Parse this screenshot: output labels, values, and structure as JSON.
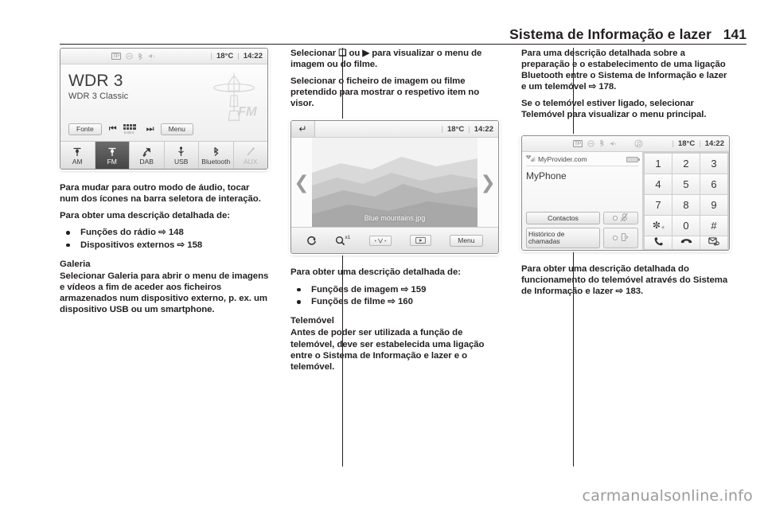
{
  "header": {
    "title": "Sistema de Informação e lazer",
    "page_number": "141"
  },
  "radio_screen": {
    "status": {
      "tp": "TP",
      "temperature": "18°C",
      "time": "14:22",
      "icons": [
        "tp-badge-icon",
        "no-traffic-icon",
        "bluetooth-icon",
        "mute-icon"
      ]
    },
    "station_name": "WDR 3",
    "station_info": "WDR 3 Classic",
    "band_logo": "FM",
    "controls": {
      "source_label": "Fonte",
      "prev_icon": "skip-previous-icon",
      "keypad_icon": "keypad-icon",
      "keypad_sublabel": "Entbriz",
      "next_icon": "skip-next-icon",
      "menu_label": "Menu"
    },
    "tabs": [
      {
        "label": "AM",
        "icon": "antenna-icon",
        "state": "normal"
      },
      {
        "label": "FM",
        "icon": "antenna-icon",
        "state": "active"
      },
      {
        "label": "DAB",
        "icon": "satellite-icon",
        "state": "normal"
      },
      {
        "label": "USB",
        "icon": "usb-icon",
        "state": "normal"
      },
      {
        "label": "Bluetooth",
        "icon": "bluetooth-icon",
        "state": "normal"
      },
      {
        "label": "AUX",
        "icon": "aux-plug-icon",
        "state": "disabled"
      }
    ]
  },
  "gallery_screen": {
    "back_icon": "back-arrow-icon",
    "temperature": "18°C",
    "time": "14:22",
    "prev_chevron": "chevron-left-icon",
    "next_chevron": "chevron-right-icon",
    "photo_filename": "Blue mountains.jpg",
    "toolbar": {
      "rotate_icon": "rotate-icon",
      "zoom_icon": "zoom-icon",
      "zoom_level": "x1",
      "adjust_icon": "fit-screen-icon",
      "slideshow_icon": "slideshow-play-icon",
      "menu_label": "Menu"
    }
  },
  "phone_screen": {
    "status": {
      "tp": "TP",
      "temperature": "18°C",
      "time": "14:22",
      "icons": [
        "tp-badge-icon",
        "no-traffic-icon",
        "bluetooth-icon",
        "mute-icon",
        "media-note-icon"
      ]
    },
    "provider": "MyProvider.com",
    "signal_icon": "signal-bars-icon",
    "battery_icon": "battery-icon",
    "phone_name": "MyPhone",
    "contacts_label": "Contactos",
    "call_history_label": "Histórico de chamadas",
    "toggle_icons": [
      "mute-microphone-icon",
      "handset-transfer-icon"
    ],
    "keypad": [
      {
        "label": "1",
        "sup": ""
      },
      {
        "label": "2",
        "sup": ""
      },
      {
        "label": "3",
        "sup": ""
      },
      {
        "label": "4",
        "sup": ""
      },
      {
        "label": "5",
        "sup": ""
      },
      {
        "label": "6",
        "sup": ""
      },
      {
        "label": "7",
        "sup": ""
      },
      {
        "label": "8",
        "sup": ""
      },
      {
        "label": "9",
        "sup": ""
      },
      {
        "label": "✼",
        "sup": "+"
      },
      {
        "label": "0",
        "sup": ""
      },
      {
        "label": "#",
        "sup": ""
      }
    ],
    "call_buttons": [
      {
        "icon": "call-answer-icon"
      },
      {
        "icon": "call-end-icon"
      },
      {
        "icon": "voicemail-icon"
      }
    ]
  },
  "column_left": {
    "p1": "Para mudar para outro modo de áudio, tocar num dos ícones na barra seletora de interação.",
    "p2": "Para obter uma descrição detalhada de:",
    "bullets": [
      {
        "text": "Funções do rádio",
        "arrow": "⇨",
        "page": "148"
      },
      {
        "text": "Dispositivos externos",
        "arrow": "⇨",
        "page": "158"
      }
    ],
    "heading": "Galeria",
    "p3": "Selecionar Galeria para abrir o menu de imagens e vídeos a fim de aceder aos ficheiros armazenados num dispositivo externo, p. ex. um dispositivo USB ou um smartphone."
  },
  "column_middle": {
    "p1": "Selecionar ❑ ou ▶ para visualizar o menu de imagem ou do filme.",
    "p2": "Selecionar o ficheiro de imagem ou filme pretendido para mostrar o respetivo item no visor.",
    "p3": "Para obter uma descrição detalhada de:",
    "bullets": [
      {
        "text": "Funções de imagem",
        "arrow": "⇨",
        "page": "159"
      },
      {
        "text": "Funções de filme",
        "arrow": "⇨",
        "page": "160"
      }
    ],
    "heading": "Telemóvel",
    "p4": "Antes de poder ser utilizada a função de telemóvel, deve ser estabelecida uma ligação entre o Sistema de Informação e lazer e o telemóvel."
  },
  "column_right": {
    "p1": "Para uma descrição detalhada sobre a preparação e o estabelecimento de uma ligação Bluetooth entre o Sistema de Informação e lazer e um telemóvel ⇨ 178.",
    "p2": "Se o telemóvel estiver ligado, selecionar Telemóvel para visualizar o menu principal.",
    "p3": "Para obter uma descrição detalhada do funcionamento do telemóvel através do Sistema de Informação e lazer ⇨ 183."
  },
  "watermark": "carmanualsonline.info"
}
